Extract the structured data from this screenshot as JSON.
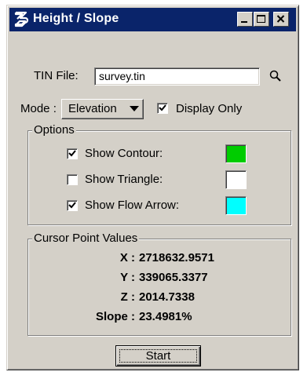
{
  "window": {
    "title": "Height / Slope",
    "title_bg": "#0a246a"
  },
  "tin": {
    "label": "TIN File:",
    "value": "survey.tin"
  },
  "mode": {
    "label": "Mode :",
    "selected": "Elevation",
    "display_only_label": "Display Only",
    "display_only_checked": true
  },
  "options": {
    "title": "Options",
    "items": [
      {
        "label": "Show Contour:",
        "checked": true,
        "color": "#00cc00"
      },
      {
        "label": "Show Triangle:",
        "checked": false,
        "color": "#ffffff"
      },
      {
        "label": "Show Flow Arrow:",
        "checked": true,
        "color": "#00ffff"
      }
    ]
  },
  "cursor": {
    "title": "Cursor Point Values",
    "rows": [
      {
        "label": "X :",
        "value": "2718632.9571"
      },
      {
        "label": "Y :",
        "value": "339065.3377"
      },
      {
        "label": "Z :",
        "value": "2014.7338"
      },
      {
        "label": "Slope :",
        "value": "23.4981%"
      }
    ]
  },
  "start_label": "Start",
  "icons": {
    "app": "bentley-b-icon",
    "search": "magnifier-icon",
    "minimize": "minimize-icon",
    "maximize": "maximize-icon",
    "close": "close-icon"
  }
}
